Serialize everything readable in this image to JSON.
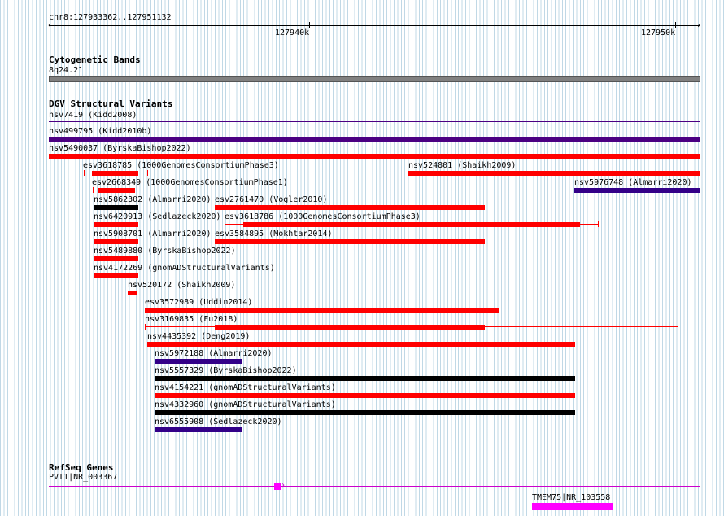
{
  "ruler": {
    "location": "chr8:127933362..127951132",
    "tick_labels": [
      "127940k",
      "127950k"
    ]
  },
  "cytoband": {
    "title": "Cytogenetic Bands",
    "band": "8q24.21",
    "color": "#808080"
  },
  "dgv": {
    "title": "DGV Structural Variants",
    "colors": {
      "red": "#ff0000",
      "purple": "#4b0082",
      "navy": "#330088",
      "black": "#000000"
    },
    "variants": [
      {
        "label": "nsv7419 (Kidd2008)",
        "color": "purple-thin"
      },
      {
        "label": "nsv499795 (Kidd2010b)",
        "color": "purple"
      },
      {
        "label": "nsv5490037 (ByrskaBishop2022)",
        "color": "red"
      },
      {
        "label": "esv3618785 (1000GenomesConsortiumPhase3)",
        "color": "red"
      },
      {
        "label": "nsv524801 (Shaikh2009)",
        "color": "red"
      },
      {
        "label": "esv2668349 (1000GenomesConsortiumPhase1)",
        "color": "red"
      },
      {
        "label": "nsv5976748 (Almarri2020)",
        "color": "navy"
      },
      {
        "label": "nsv5862302 (Almarri2020)",
        "color": "black"
      },
      {
        "label": "esv2761470 (Vogler2010)",
        "color": "red"
      },
      {
        "label": "nsv6420913 (Sedlazeck2020)",
        "color": "red"
      },
      {
        "label": "esv3618786 (1000GenomesConsortiumPhase3)",
        "color": "red"
      },
      {
        "label": "nsv5908701 (Almarri2020)",
        "color": "red"
      },
      {
        "label": "esv3584895 (Mokhtar2014)",
        "color": "red"
      },
      {
        "label": "nsv5489880 (ByrskaBishop2022)",
        "color": "red"
      },
      {
        "label": "nsv4172269 (gnomADStructuralVariants)",
        "color": "red"
      },
      {
        "label": "nsv520172 (Shaikh2009)",
        "color": "red"
      },
      {
        "label": "esv3572989 (Uddin2014)",
        "color": "red"
      },
      {
        "label": "nsv3169835 (Fu2018)",
        "color": "red"
      },
      {
        "label": "nsv4435392 (Deng2019)",
        "color": "red"
      },
      {
        "label": "nsv5972188 (Almarri2020)",
        "color": "navy"
      },
      {
        "label": "nsv5557329 (ByrskaBishop2022)",
        "color": "black"
      },
      {
        "label": "nsv4154221 (gnomADStructuralVariants)",
        "color": "red"
      },
      {
        "label": "nsv4332960 (gnomADStructuralVariants)",
        "color": "black"
      },
      {
        "label": "nsv6555908 (Sedlazeck2020)",
        "color": "navy"
      }
    ]
  },
  "refseq": {
    "title": "RefSeq Genes",
    "genes": [
      {
        "label": "PVT1|NR_003367",
        "color": "#cc00cc"
      },
      {
        "label": "TMEM75|NR_103558",
        "color": "#ff00ff"
      }
    ]
  }
}
